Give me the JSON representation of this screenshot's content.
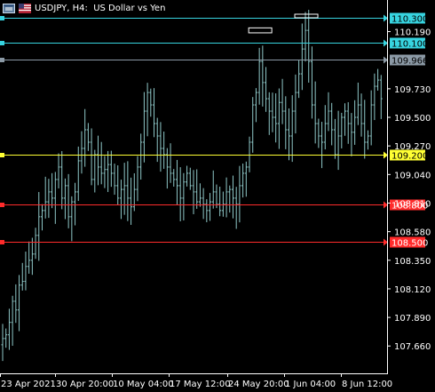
{
  "window": {
    "symbol": "USDJPY",
    "timeframe": "H4",
    "description": "US Dollar vs Yen",
    "header_text": "USDJPY, H4:  US Dollar vs Yen"
  },
  "icons": [
    "window-icon",
    "flag-icon"
  ],
  "colors": {
    "background": "#000000",
    "bars": "#8fc8c8",
    "axis": "#ffffff",
    "tick_text": "#ffffff",
    "level_cyan": "#37d4e0",
    "level_gray": "#8c9aa6",
    "level_yellow": "#ffff33",
    "level_red": "#ff2b2b"
  },
  "chart_data": {
    "type": "ohlc",
    "price_axis_ticks": [
      "110.190",
      "109.730",
      "109.500",
      "109.270",
      "109.040",
      "108.810",
      "108.580",
      "108.350",
      "108.120",
      "107.890",
      "107.660"
    ],
    "time_axis_labels": [
      "23 Apr 2021",
      "30 Apr 20:00",
      "10 May 04:00",
      "17 May 12:00",
      "24 May 20:00",
      "1 Jun 04:00",
      "8 Jun 12:00"
    ],
    "ylim": [
      107.44,
      110.43
    ],
    "levels": [
      {
        "label": "110.300",
        "value": 110.3,
        "style": "cyan"
      },
      {
        "label": "110.100",
        "value": 110.1,
        "style": "cyan"
      },
      {
        "label": "109.966",
        "value": 109.966,
        "style": "gray"
      },
      {
        "label": "109.200",
        "value": 109.2,
        "style": "yellow"
      },
      {
        "label": "108.800",
        "value": 108.8,
        "style": "red"
      },
      {
        "label": "108.500",
        "value": 108.5,
        "style": "red"
      }
    ],
    "range_boxes": [
      {
        "x_bar": 78,
        "high": 110.22,
        "low": 110.18
      },
      {
        "x_bar": 92,
        "high": 110.33,
        "low": 110.31
      }
    ],
    "closes": [
      107.72,
      107.75,
      107.85,
      108.02,
      107.95,
      108.15,
      108.18,
      108.3,
      108.35,
      108.4,
      108.55,
      108.7,
      108.75,
      108.82,
      108.9,
      108.85,
      109.0,
      109.1,
      108.85,
      108.95,
      108.7,
      108.82,
      108.9,
      109.15,
      109.25,
      109.4,
      109.3,
      109.0,
      109.2,
      109.1,
      109.05,
      109.08,
      109.12,
      109.05,
      108.95,
      108.85,
      108.92,
      108.95,
      108.85,
      108.78,
      108.92,
      109.1,
      109.3,
      109.55,
      109.7,
      109.6,
      109.45,
      109.35,
      109.25,
      109.2,
      109.1,
      109.05,
      109.0,
      108.95,
      108.85,
      108.98,
      109.05,
      108.95,
      108.9,
      108.82,
      108.85,
      108.8,
      108.75,
      108.82,
      108.9,
      108.8,
      108.75,
      108.8,
      108.9,
      108.92,
      108.85,
      108.8,
      108.95,
      109.05,
      109.1,
      109.3,
      109.6,
      109.7,
      109.95,
      109.78,
      109.65,
      109.55,
      109.5,
      109.45,
      109.62,
      109.55,
      109.4,
      109.35,
      109.55,
      109.7,
      109.85,
      110.05,
      110.2,
      109.95,
      109.6,
      109.45,
      109.35,
      109.3,
      109.45,
      109.55,
      109.4,
      109.2,
      109.35,
      109.5,
      109.55,
      109.45,
      109.38,
      109.5,
      109.6,
      109.45,
      109.3,
      109.35,
      109.6,
      109.75,
      109.8,
      109.65
    ]
  }
}
